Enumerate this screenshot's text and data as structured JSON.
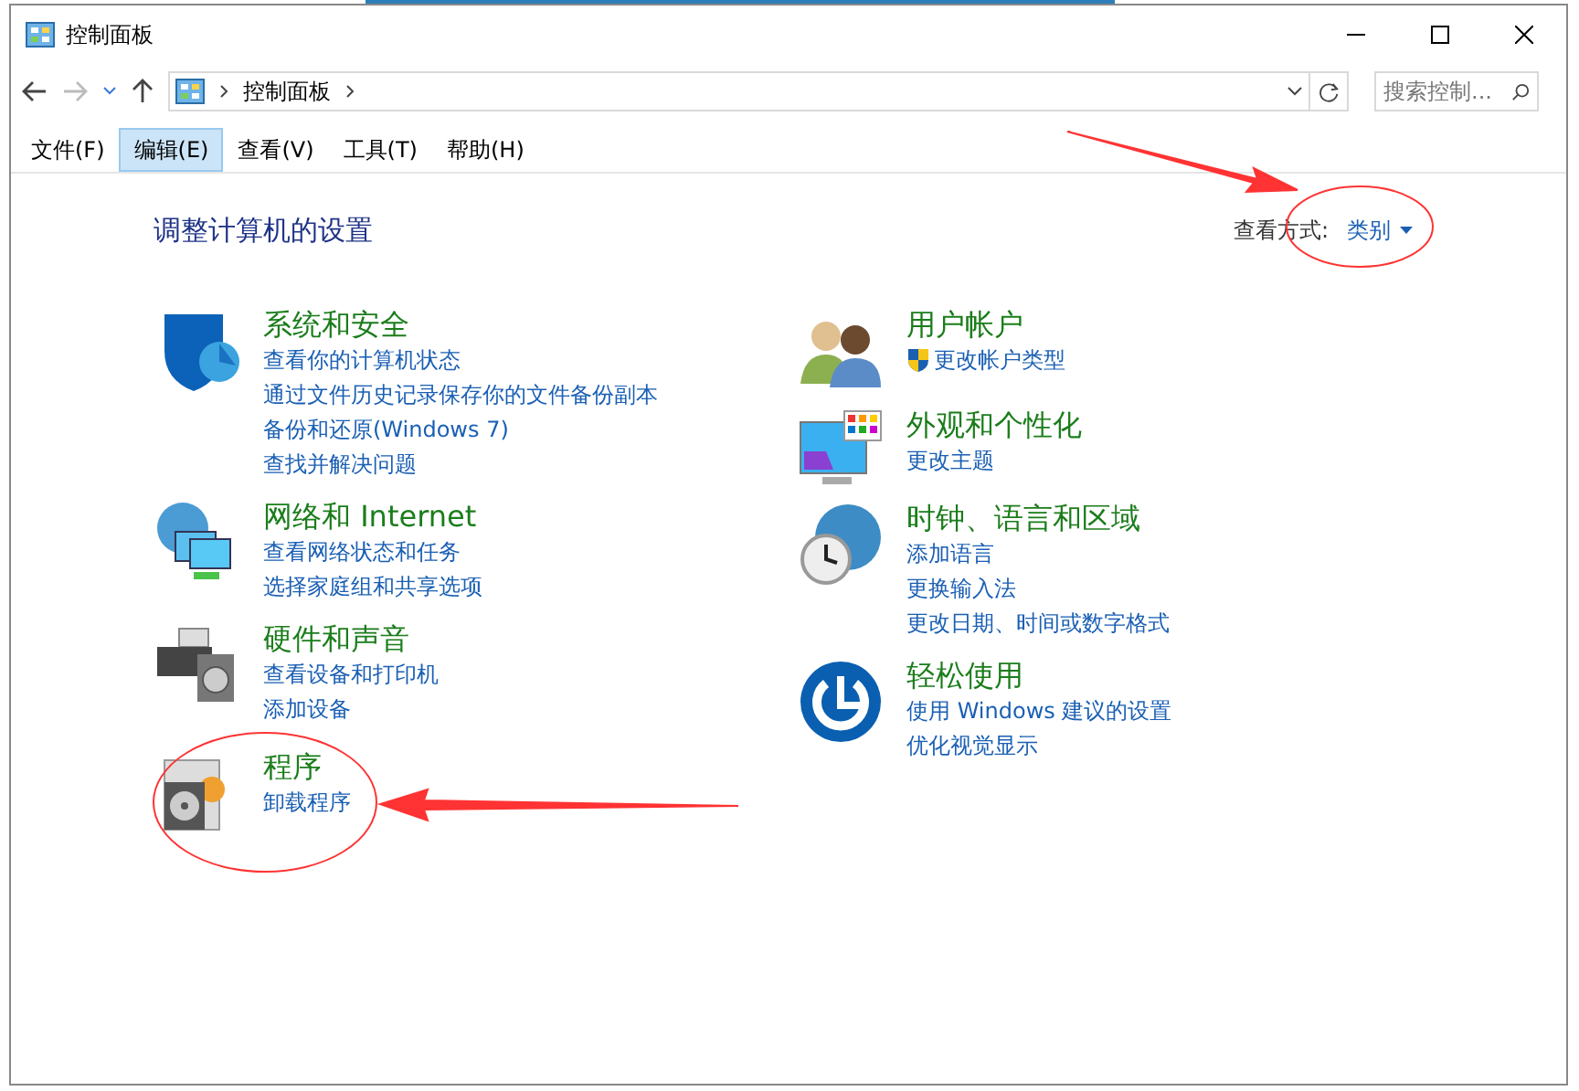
{
  "window": {
    "title": "控制面板"
  },
  "address_bar": {
    "path": [
      "控制面板"
    ],
    "search": {
      "placeholder": "搜索控制..."
    }
  },
  "menu": [
    {
      "label": "文件(F)",
      "selected": false
    },
    {
      "label": "编辑(E)",
      "selected": true
    },
    {
      "label": "查看(V)",
      "selected": false
    },
    {
      "label": "工具(T)",
      "selected": false
    },
    {
      "label": "帮助(H)",
      "selected": false
    }
  ],
  "heading": "调整计算机的设置",
  "view_by": {
    "label": "查看方式:",
    "value": "类别"
  },
  "categories_left": [
    {
      "title": "系统和安全",
      "links": [
        {
          "text": "查看你的计算机状态"
        },
        {
          "text": "通过文件历史记录保存你的文件备份副本"
        },
        {
          "text": "备份和还原(Windows 7)"
        },
        {
          "text": "查找并解决问题"
        }
      ]
    },
    {
      "title": "网络和 Internet",
      "links": [
        {
          "text": "查看网络状态和任务"
        },
        {
          "text": "选择家庭组和共享选项"
        }
      ]
    },
    {
      "title": "硬件和声音",
      "links": [
        {
          "text": "查看设备和打印机"
        },
        {
          "text": "添加设备"
        }
      ]
    },
    {
      "title": "程序",
      "links": [
        {
          "text": "卸载程序"
        }
      ]
    }
  ],
  "categories_right": [
    {
      "title": "用户帐户",
      "links": [
        {
          "text": "更改帐户类型",
          "shield": true
        }
      ]
    },
    {
      "title": "外观和个性化",
      "links": [
        {
          "text": "更改主题"
        }
      ]
    },
    {
      "title": "时钟、语言和区域",
      "links": [
        {
          "text": "添加语言"
        },
        {
          "text": "更换输入法"
        },
        {
          "text": "更改日期、时间或数字格式"
        }
      ]
    },
    {
      "title": "轻松使用",
      "links": [
        {
          "text": "使用 Windows 建议的设置"
        },
        {
          "text": "优化视觉显示"
        }
      ]
    }
  ]
}
